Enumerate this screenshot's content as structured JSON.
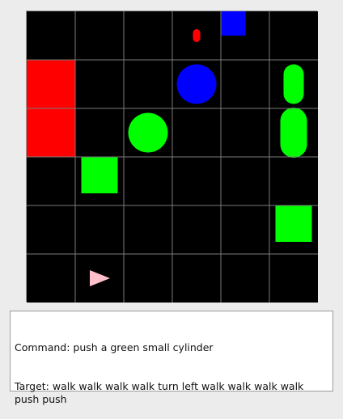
{
  "grid": {
    "rows": 6,
    "cols": 6,
    "background": "#000000",
    "line_color": "#7a7a7a"
  },
  "objects": [
    {
      "name": "red-tall-rectangle",
      "shape": "rectangle",
      "color": "#ff0000",
      "row": 1,
      "col": 0,
      "row_span": 2,
      "col_span": 1,
      "size": "big"
    },
    {
      "name": "blue-small-square",
      "shape": "square",
      "color": "#0000ff",
      "row": 0,
      "col": 4,
      "size": "small"
    },
    {
      "name": "red-small-cylinder",
      "shape": "cylinder",
      "color": "#ff0000",
      "row": 0,
      "col": 3,
      "size": "tiny"
    },
    {
      "name": "blue-circle",
      "shape": "circle",
      "color": "#0000ff",
      "row": 1,
      "col": 3,
      "size": "medium"
    },
    {
      "name": "green-small-cylinder",
      "shape": "cylinder",
      "color": "#00ff00",
      "row": 1,
      "col": 5,
      "size": "small"
    },
    {
      "name": "green-big-cylinder",
      "shape": "cylinder",
      "color": "#00ff00",
      "row": 2,
      "col": 5,
      "size": "big"
    },
    {
      "name": "green-circle",
      "shape": "circle",
      "color": "#00ff00",
      "row": 2,
      "col": 2,
      "size": "medium"
    },
    {
      "name": "green-square-1",
      "shape": "square",
      "color": "#00ff00",
      "row": 3,
      "col": 1,
      "size": "medium"
    },
    {
      "name": "green-square-2",
      "shape": "square",
      "color": "#00ff00",
      "row": 4,
      "col": 5,
      "size": "medium"
    },
    {
      "name": "agent-triangle",
      "shape": "triangle",
      "color": "#ffc0cb",
      "row": 5,
      "col": 1,
      "direction": "right"
    }
  ],
  "panel": {
    "command": "Command: push a green small cylinder",
    "target": "Target: walk walk walk walk turn left walk walk walk walk push push"
  }
}
